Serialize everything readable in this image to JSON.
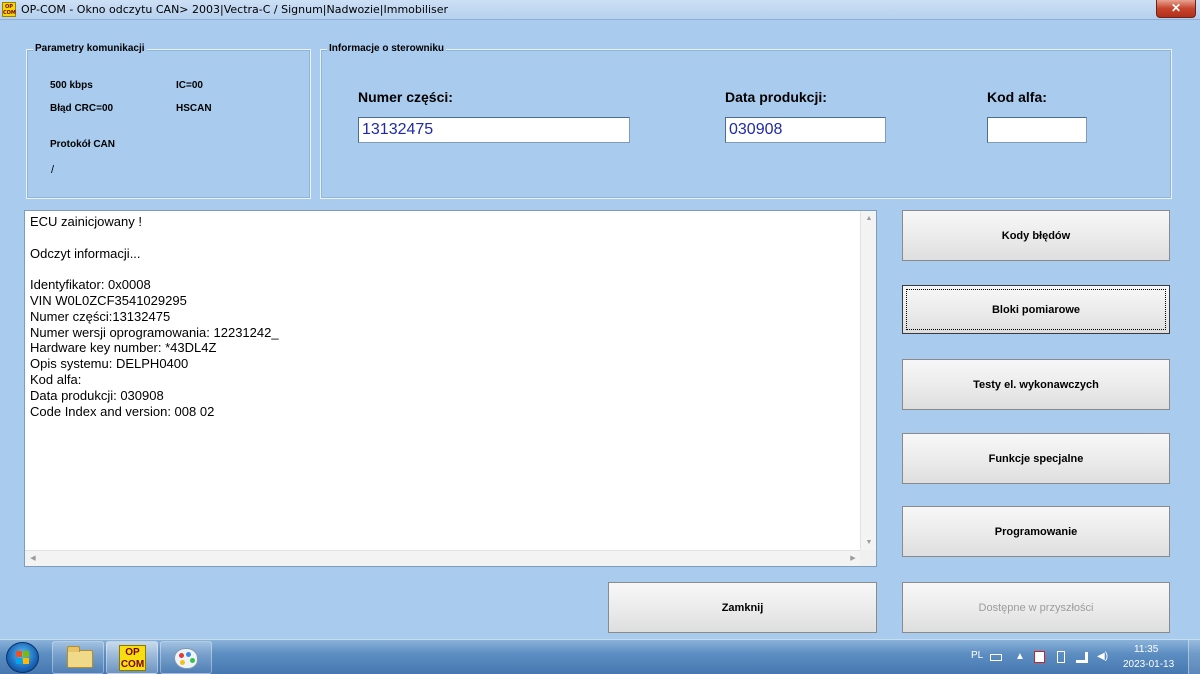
{
  "window": {
    "icon_text": "OP COM",
    "title": "OP-COM - Okno odczytu CAN> 2003|Vectra-C / Signum|Nadwozie|Immobiliser",
    "close_label": "✕"
  },
  "comm_params": {
    "title": "Parametry komunikacji",
    "baud": "500 kbps",
    "ic": "IC=00",
    "crc": "Błąd CRC=00",
    "bus": "HSCAN",
    "protocol_label": "Protokół CAN",
    "protocol_value": "/"
  },
  "ecu_info": {
    "title": "Informacje o sterowniku",
    "part_number_label": "Numer części:",
    "part_number_value": "13132475",
    "prod_date_label": "Data produkcji:",
    "prod_date_value": "030908",
    "alpha_code_label": "Kod alfa:",
    "alpha_code_value": ""
  },
  "log": {
    "lines": [
      "ECU zainicjowany !",
      "",
      "Odczyt informacji...",
      "",
      "Identyfikator: 0x0008",
      "VIN W0L0ZCF3541029295",
      "Numer części:13132475",
      "Numer wersji oprogramowania: 12231242_",
      "Hardware key number: *43DL4Z",
      "Opis systemu: DELPH0400",
      "Kod alfa:",
      "Data produkcji: 030908",
      "Code Index and version: 008 02"
    ]
  },
  "buttons": {
    "error_codes": "Kody błędów",
    "measuring_blocks": "Bloki pomiarowe",
    "actuator_tests": "Testy el. wykonawczych",
    "special_functions": "Funkcje specjalne",
    "programming": "Programowanie",
    "close": "Zamknij",
    "future": "Dostępne w przyszłości"
  },
  "taskbar": {
    "opcom_icon_text": "OP COM",
    "language": "PL",
    "time": "11:35",
    "date": "2023-01-13"
  }
}
